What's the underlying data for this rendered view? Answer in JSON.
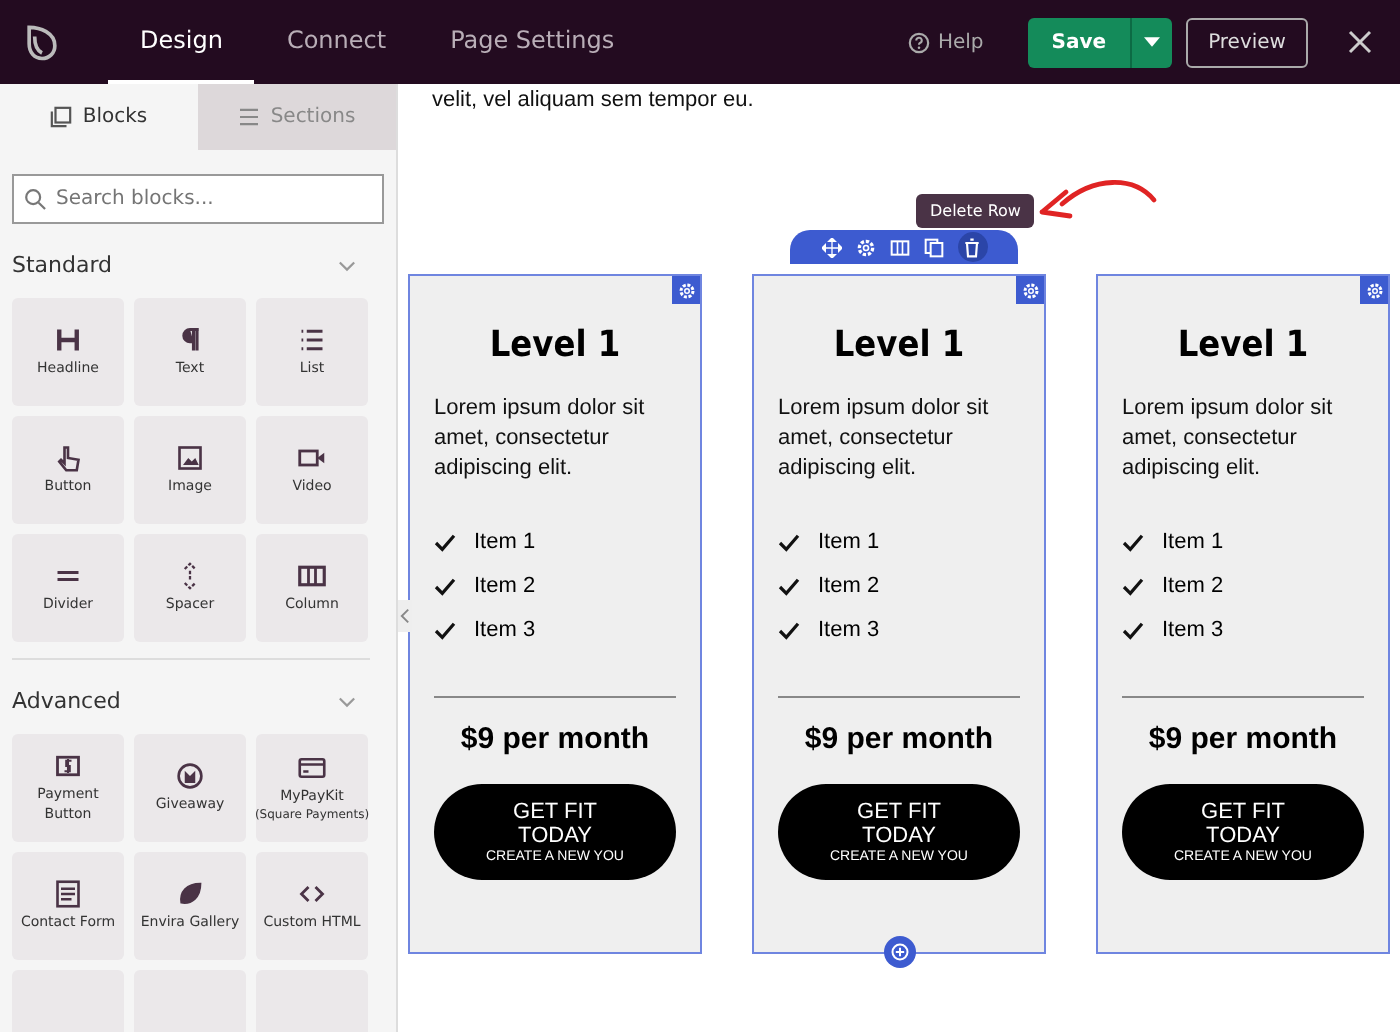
{
  "topbar": {
    "tabs": [
      {
        "label": "Design",
        "selected": true
      },
      {
        "label": "Connect",
        "selected": false
      },
      {
        "label": "Page Settings",
        "selected": false
      }
    ],
    "help": "Help",
    "save": "Save",
    "preview": "Preview"
  },
  "sidebar": {
    "tabs": [
      {
        "label": "Blocks",
        "selected": true
      },
      {
        "label": "Sections",
        "selected": false
      }
    ],
    "search": {
      "placeholder": "Search blocks..."
    },
    "groups": [
      {
        "title": "Standard",
        "expanded": true,
        "blocks": [
          {
            "label": "Headline"
          },
          {
            "label": "Text"
          },
          {
            "label": "List"
          },
          {
            "label": "Button"
          },
          {
            "label": "Image"
          },
          {
            "label": "Video"
          },
          {
            "label": "Divider"
          },
          {
            "label": "Spacer"
          },
          {
            "label": "Column"
          }
        ]
      },
      {
        "title": "Advanced",
        "expanded": true,
        "blocks": [
          {
            "label": "Payment Button"
          },
          {
            "label": "Giveaway"
          },
          {
            "label": "MyPayKit",
            "sublabel": "(Square Payments)"
          },
          {
            "label": "Contact Form"
          },
          {
            "label": "Envira Gallery"
          },
          {
            "label": "Custom HTML"
          }
        ]
      }
    ]
  },
  "canvas": {
    "intro_text": "velit, vel aliquam sem tempor eu.",
    "tooltip": "Delete Row",
    "cards": [
      {
        "title": "Level 1",
        "description": "Lorem ipsum dolor sit amet, consectetur adipiscing elit.",
        "items": [
          "Item 1",
          "Item 2",
          "Item 3"
        ],
        "price": "$9 per month",
        "button_title": "GET FIT TODAY",
        "button_subtitle": "CREATE A NEW YOU"
      },
      {
        "title": "Level 1",
        "description": "Lorem ipsum dolor sit amet, consectetur adipiscing elit.",
        "items": [
          "Item 1",
          "Item 2",
          "Item 3"
        ],
        "price": "$9 per month",
        "button_title": "GET FIT TODAY",
        "button_subtitle": "CREATE A NEW YOU"
      },
      {
        "title": "Level 1",
        "description": "Lorem ipsum dolor sit amet, consectetur adipiscing elit.",
        "items": [
          "Item 1",
          "Item 2",
          "Item 3"
        ],
        "price": "$9 per month",
        "button_title": "GET FIT TODAY",
        "button_subtitle": "CREATE A NEW YOU"
      }
    ]
  }
}
